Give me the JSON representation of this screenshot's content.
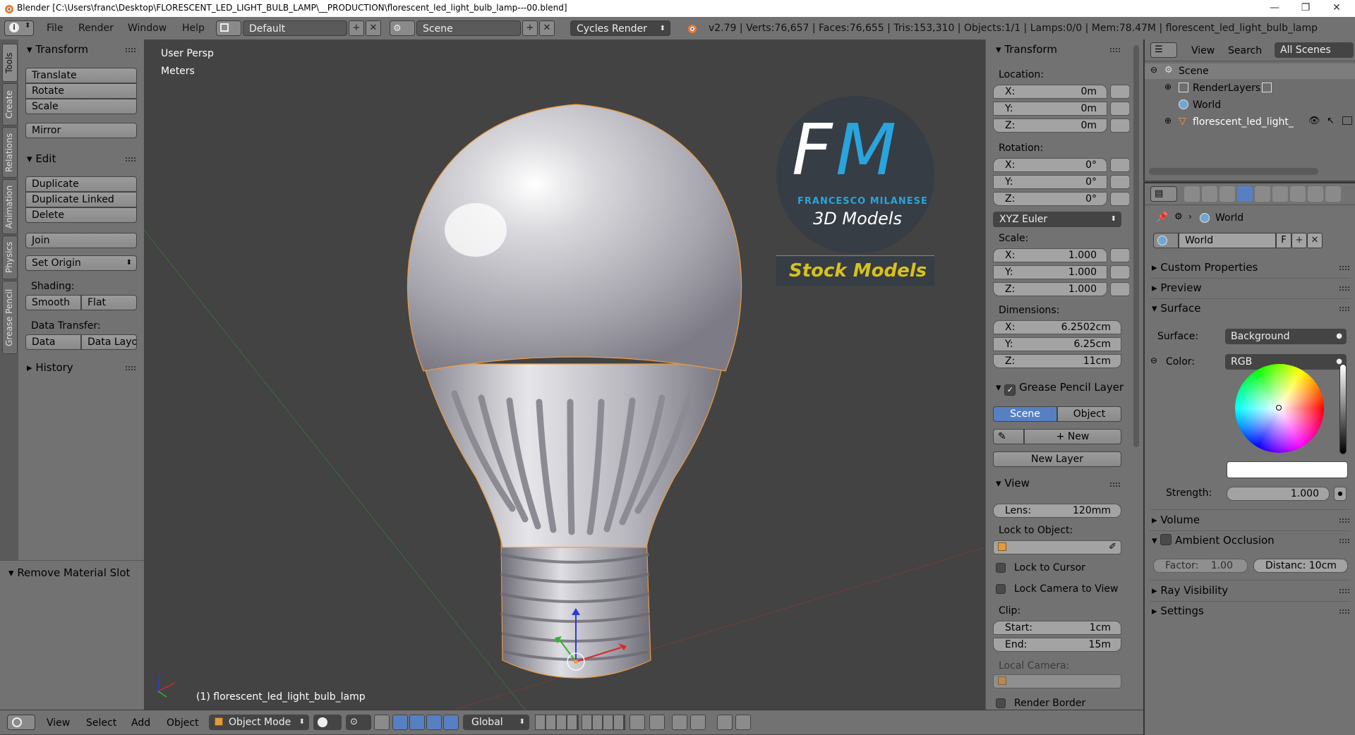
{
  "titlebar": {
    "title": "Blender [C:\\Users\\franc\\Desktop\\FLORESCENT_LED_LIGHT_BULB_LAMP\\__PRODUCTION\\florescent_led_light_bulb_lamp---00.blend]",
    "minimize": "—",
    "maximize": "❐",
    "close": "✕"
  },
  "infobar": {
    "menus": [
      "File",
      "Render",
      "Window",
      "Help"
    ],
    "layout": "Default",
    "scene": "Scene",
    "engine": "Cycles Render",
    "stats": "v2.79 | Verts:76,657 | Faces:76,655 | Tris:153,310 | Objects:1/1 | Lamps:0/0 | Mem:78.47M | florescent_led_light_bulb_lamp"
  },
  "vtabs": [
    "Tools",
    "Create",
    "Relations",
    "Animation",
    "Physics",
    "Grease Pencil"
  ],
  "toolshelf": {
    "transform_header": "Transform",
    "transform_buttons": [
      "Translate",
      "Rotate",
      "Scale"
    ],
    "mirror": "Mirror",
    "edit_header": "Edit",
    "edit_buttons": [
      "Duplicate",
      "Duplicate Linked",
      "Delete"
    ],
    "join": "Join",
    "set_origin": "Set Origin",
    "shading_label": "Shading:",
    "smooth": "Smooth",
    "flat": "Flat",
    "data_transfer_label": "Data Transfer:",
    "data": "Data",
    "data_layo": "Data Layo",
    "history": "History"
  },
  "operator_panel": {
    "title": "Remove Material Slot"
  },
  "viewport": {
    "view_name": "User Persp",
    "units": "Meters",
    "object_label": "(1) florescent_led_light_bulb_lamp",
    "logo": {
      "letters_f": "F",
      "letters_m": "M",
      "author": "FRANCESCO MILANESE",
      "subtitle": "3D Models",
      "banner": "Stock Models"
    }
  },
  "npanel": {
    "transform_header": "Transform",
    "location_label": "Location:",
    "location": [
      {
        "k": "X:",
        "v": "0m"
      },
      {
        "k": "Y:",
        "v": "0m"
      },
      {
        "k": "Z:",
        "v": "0m"
      }
    ],
    "rotation_label": "Rotation:",
    "rotation": [
      {
        "k": "X:",
        "v": "0°"
      },
      {
        "k": "Y:",
        "v": "0°"
      },
      {
        "k": "Z:",
        "v": "0°"
      }
    ],
    "rotation_mode": "XYZ Euler",
    "scale_label": "Scale:",
    "scale": [
      {
        "k": "X:",
        "v": "1.000"
      },
      {
        "k": "Y:",
        "v": "1.000"
      },
      {
        "k": "Z:",
        "v": "1.000"
      }
    ],
    "dimensions_label": "Dimensions:",
    "dimensions": [
      {
        "k": "X:",
        "v": "6.2502cm"
      },
      {
        "k": "Y:",
        "v": "6.25cm"
      },
      {
        "k": "Z:",
        "v": "11cm"
      }
    ],
    "grease_header": "Grease Pencil Layer",
    "scene_tab": "Scene",
    "object_tab": "Object",
    "new": "New",
    "new_layer": "New Layer",
    "view_header": "View",
    "lens_k": "Lens:",
    "lens_v": "120mm",
    "lock_to_object": "Lock to Object:",
    "lock_to_cursor": "Lock to Cursor",
    "lock_camera": "Lock Camera to View",
    "clip_label": "Clip:",
    "clip_start_k": "Start:",
    "clip_start_v": "1cm",
    "clip_end_k": "End:",
    "clip_end_v": "15m",
    "local_camera": "Local Camera:",
    "render_border": "Render Border"
  },
  "outliner": {
    "view": "View",
    "search": "Search",
    "all_scenes": "All Scenes",
    "items": [
      "Scene",
      "RenderLayers",
      "World",
      "florescent_led_light_bu"
    ]
  },
  "properties": {
    "breadcrumb": "World",
    "world_name": "World",
    "fake_user": "F",
    "sections": [
      "Custom Properties",
      "Preview",
      "Surface"
    ],
    "surface_label": "Surface:",
    "surface_value": "Background",
    "color_label": "Color:",
    "color_value": "RGB",
    "strength_k": "Strength:",
    "strength_v": "1.000",
    "volume": "Volume",
    "ambient_occlusion": "Ambient Occlusion",
    "factor": "Factor:",
    "factor_v": "1.00",
    "distance": "Distanc: 10cm",
    "ray_visibility": "Ray Visibility",
    "settings": "Settings"
  },
  "bottombar": {
    "menus": [
      "View",
      "Select",
      "Add",
      "Object"
    ],
    "mode": "Object Mode",
    "orientation": "Global"
  },
  "colors": {
    "accent": "#5680c2",
    "selection_outline": "#f09a3a",
    "logo_blue": "#2aa4dc",
    "logo_yellow": "#d8c11b"
  }
}
